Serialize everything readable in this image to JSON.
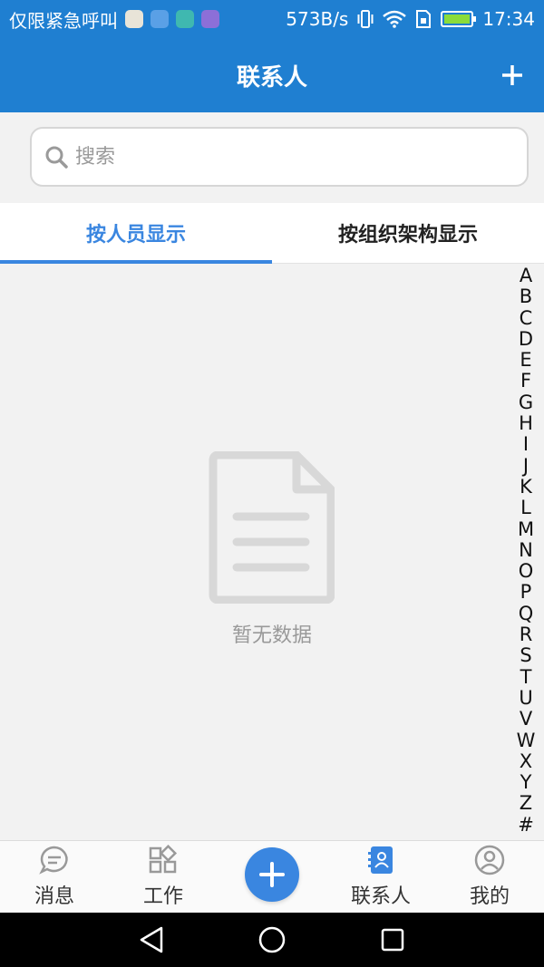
{
  "status_bar": {
    "carrier": "仅限紧急呼叫",
    "net_speed": "573B/s",
    "time": "17:34"
  },
  "header": {
    "title": "联系人"
  },
  "search": {
    "placeholder": "搜索"
  },
  "tabs": [
    {
      "label": "按人员显示",
      "active": true
    },
    {
      "label": "按组织架构显示",
      "active": false
    }
  ],
  "empty_state": {
    "text": "暂无数据"
  },
  "index_letters": [
    "A",
    "B",
    "C",
    "D",
    "E",
    "F",
    "G",
    "H",
    "I",
    "J",
    "K",
    "L",
    "M",
    "N",
    "O",
    "P",
    "Q",
    "R",
    "S",
    "T",
    "U",
    "V",
    "W",
    "X",
    "Y",
    "Z",
    "#"
  ],
  "bottom_nav": {
    "messages": "消息",
    "work": "工作",
    "contacts": "联系人",
    "mine": "我的"
  },
  "colors": {
    "header_bg": "#1f7fd1",
    "accent": "#3a86e0"
  }
}
